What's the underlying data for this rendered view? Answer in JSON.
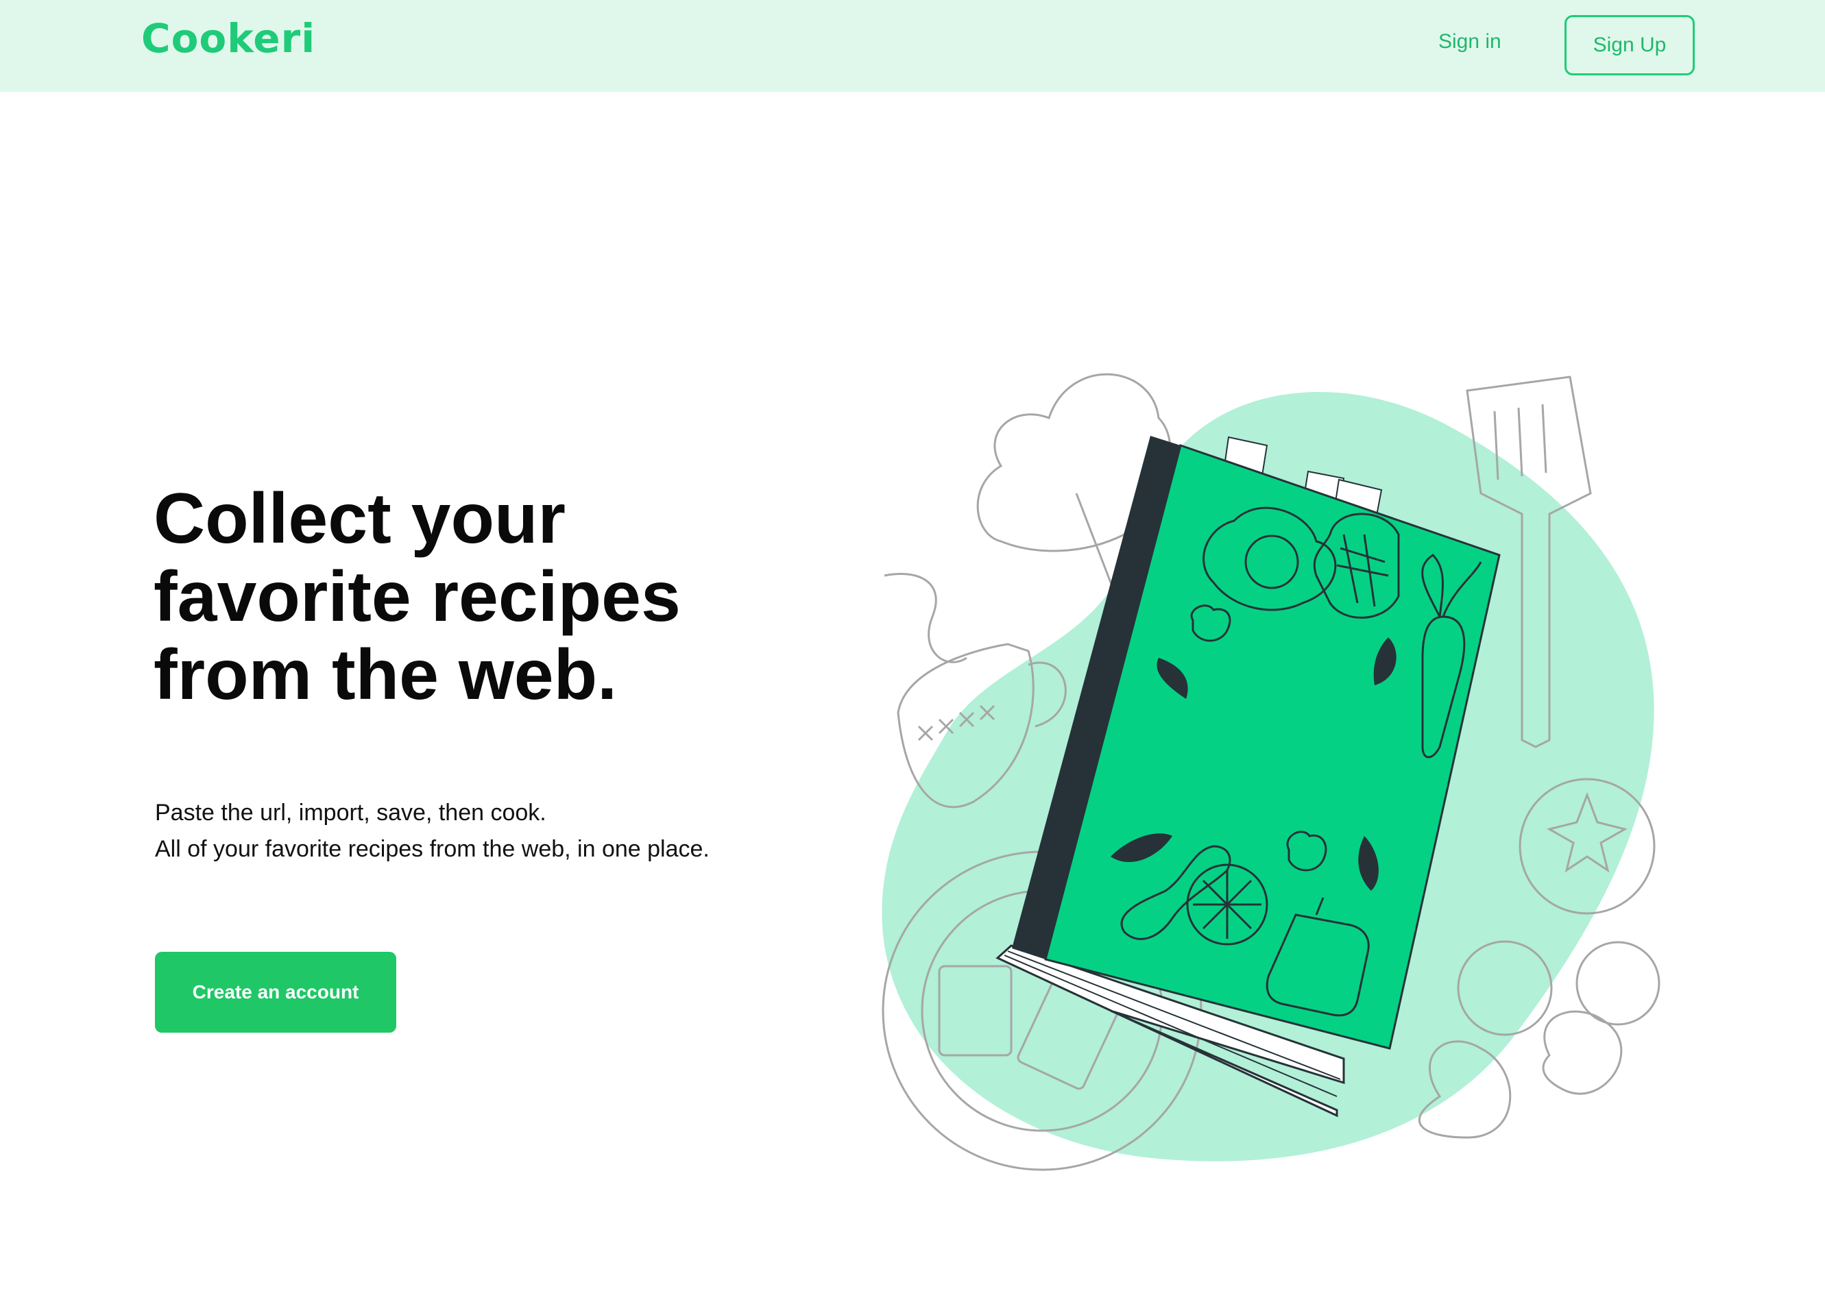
{
  "header": {
    "logo": "Cookeri",
    "signin_label": "Sign in",
    "signup_label": "Sign Up"
  },
  "hero": {
    "headline_lines": [
      "Collect your",
      "favorite recipes",
      "from the web."
    ],
    "subtext_lines": [
      "Paste the url, import, save, then cook.",
      "All of your favorite recipes from the web, in one place."
    ],
    "cta_label": "Create an account"
  },
  "colors": {
    "brand": "#1fcb79",
    "nav_bg": "#e0f8ec",
    "cta_bg": "#1fc766",
    "blob": "#b2f0d8",
    "book": "#05d184"
  },
  "illustration": {
    "icons": [
      "recipe-book-icon",
      "spatula-icon",
      "tomato-icon",
      "chef-hat-icon",
      "mug-icon",
      "plate-icon",
      "cracker-icon",
      "avocado-icon"
    ]
  }
}
